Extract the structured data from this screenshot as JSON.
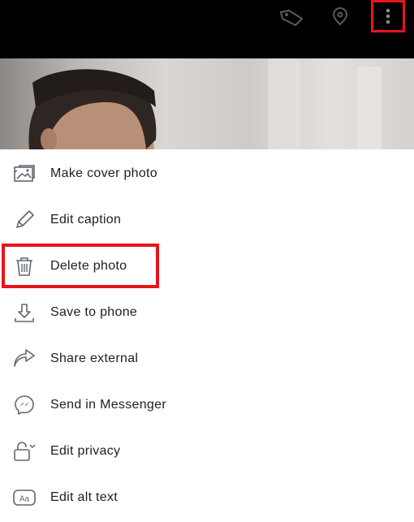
{
  "header": {
    "tag_icon": "tag-icon",
    "location_icon": "location-pin-icon",
    "more_icon": "more-vertical-icon"
  },
  "photo": {
    "description_icon": "profile-photo"
  },
  "menu": {
    "items": [
      {
        "label": "Make cover photo",
        "icon": "cover-photo-icon"
      },
      {
        "label": "Edit caption",
        "icon": "pencil-icon"
      },
      {
        "label": "Delete photo",
        "icon": "trash-icon"
      },
      {
        "label": "Save to phone",
        "icon": "download-icon"
      },
      {
        "label": "Share external",
        "icon": "share-arrow-icon"
      },
      {
        "label": "Send in Messenger",
        "icon": "messenger-icon"
      },
      {
        "label": "Edit privacy",
        "icon": "privacy-lock-icon"
      },
      {
        "label": "Edit alt text",
        "icon": "alt-text-icon"
      }
    ]
  },
  "colors": {
    "highlight": "#e8141b",
    "topbar": "#000000",
    "text": "#1c1e21",
    "icon": "#606770"
  }
}
